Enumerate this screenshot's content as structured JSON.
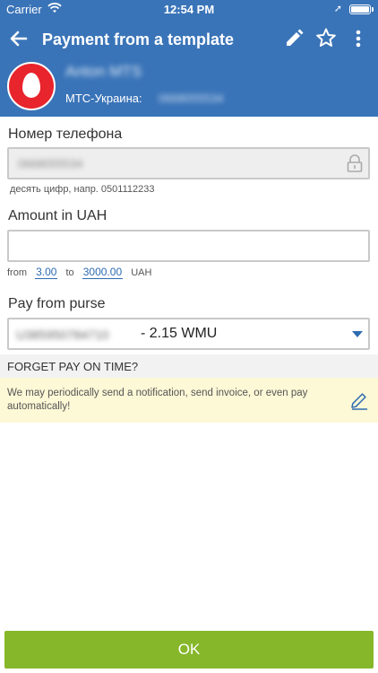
{
  "status_bar": {
    "carrier": "Carrier",
    "time": "12:54 PM"
  },
  "header": {
    "title": "Payment from a template",
    "contact_name": "Anton MTS",
    "operator_label": "МТС-Украина:",
    "operator_number": "0668055534"
  },
  "phone": {
    "label": "Номер телефона",
    "value": "0668055534",
    "hint": "десять цифр, напр. 0501112233"
  },
  "amount": {
    "label": "Amount in UAH",
    "value": "",
    "range_from_label": "from",
    "range_min": "3.00",
    "range_to_label": "to",
    "range_max": "3000.00",
    "currency": "UAH"
  },
  "purse": {
    "label": "Pay from purse",
    "purse_id": "U385950784710",
    "balance": "- 2.15 WMU"
  },
  "reminder": {
    "heading": "FORGET PAY ON TIME?",
    "text": "We may periodically send a notification, send invoice, or even pay automatically!"
  },
  "actions": {
    "ok_label": "OK"
  },
  "colors": {
    "primary": "#3a74b8",
    "accent_link": "#2d6bb1",
    "ok_button": "#86b72a",
    "notice_bg": "#fdf8d6"
  }
}
